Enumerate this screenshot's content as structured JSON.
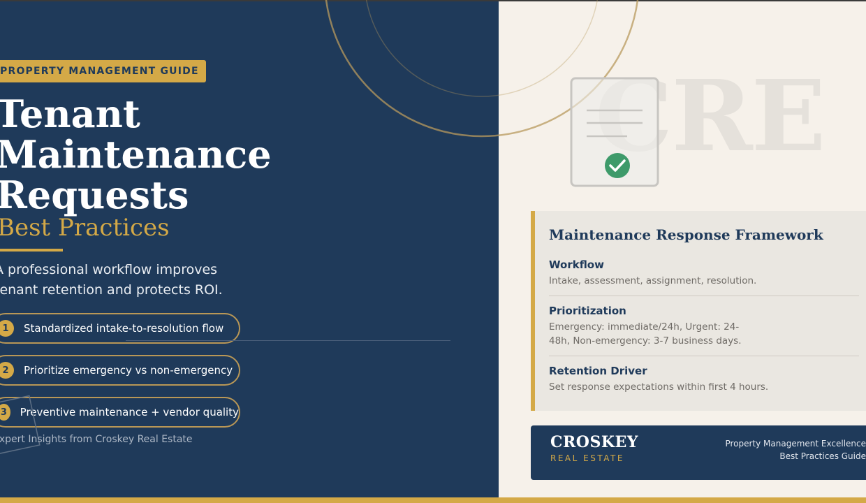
{
  "tag": "PROPERTY MANAGEMENT GUIDE",
  "title_lines": [
    "Tenant",
    "Maintenance",
    "Requests"
  ],
  "subtitle": "Best Practices",
  "description": "A professional workflow improves tenant retention and protects ROI.",
  "points": [
    {
      "num": "1",
      "text": "Standardized intake-to-resolution flow"
    },
    {
      "num": "2",
      "text": "Prioritize emergency vs non-emergency"
    },
    {
      "num": "3",
      "text": "Preventive maintenance + vendor quality"
    }
  ],
  "credit": "Expert Insights from Croskey Real Estate",
  "watermark": "CRE",
  "framework": {
    "title": "Maintenance Response Framework",
    "sections": [
      {
        "heading": "Workflow",
        "body": "Intake, assessment, assignment, resolution."
      },
      {
        "heading": "Prioritization",
        "body": "Emergency: immediate/24h, Urgent: 24-48h, Non-emergency: 3-7 business days."
      },
      {
        "heading": "Retention Driver",
        "body": "Set response expectations within first 4 hours."
      }
    ]
  },
  "footer": {
    "brand": "CROSKEY",
    "brand_sub": "REAL ESTATE",
    "line1": "Property Management Excellence",
    "line2": "Best Practices Guide"
  },
  "colors": {
    "navy": "#1f3a5a",
    "gold": "#d4a947",
    "cream": "#f6f1ea",
    "check": "#3e9a6a"
  },
  "icons": [
    "document-check-icon"
  ]
}
